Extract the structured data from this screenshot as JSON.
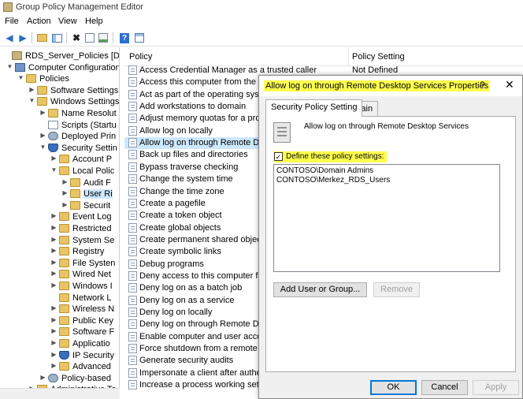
{
  "window": {
    "title": "Group Policy Management Editor"
  },
  "menu": [
    "File",
    "Action",
    "View",
    "Help"
  ],
  "toolbar": [
    "back-arrow-icon",
    "forward-arrow-icon",
    "up-folder-icon",
    "show-tree-icon",
    "delete-icon",
    "properties-icon",
    "export-icon",
    "help-icon",
    "console-icon"
  ],
  "tree": [
    {
      "label": "RDS_Server_Policies [DC.COI",
      "arrow": "",
      "icon": "policy"
    },
    {
      "label": "Computer Configuration",
      "arrow": "▼",
      "icon": "computer"
    },
    {
      "label": "Policies",
      "arrow": "▼",
      "icon": "folder"
    },
    {
      "label": "Software Settings",
      "arrow": "▶",
      "icon": "folder"
    },
    {
      "label": "Windows Settings",
      "arrow": "▼",
      "icon": "folder"
    },
    {
      "label": "Name Resolut",
      "arrow": "▶",
      "icon": "folder"
    },
    {
      "label": "Scripts (Startu",
      "arrow": "",
      "icon": "doc"
    },
    {
      "label": "Deployed Prin",
      "arrow": "▶",
      "icon": "gear"
    },
    {
      "label": "Security Settin",
      "arrow": "▼",
      "icon": "shield"
    },
    {
      "label": "Account P",
      "arrow": "▶",
      "icon": "folder"
    },
    {
      "label": "Local Polic",
      "arrow": "▼",
      "icon": "folder"
    },
    {
      "label": "Audit F",
      "arrow": "▶",
      "icon": "folder"
    },
    {
      "label": "User Ri",
      "arrow": "▶",
      "icon": "folder",
      "selected": true
    },
    {
      "label": "Securit",
      "arrow": "▶",
      "icon": "folder"
    },
    {
      "label": "Event Log",
      "arrow": "▶",
      "icon": "folder"
    },
    {
      "label": "Restricted",
      "arrow": "▶",
      "icon": "folder"
    },
    {
      "label": "System Se",
      "arrow": "▶",
      "icon": "folder"
    },
    {
      "label": "Registry",
      "arrow": "▶",
      "icon": "folder"
    },
    {
      "label": "File Systen",
      "arrow": "▶",
      "icon": "folder"
    },
    {
      "label": "Wired Net",
      "arrow": "▶",
      "icon": "folder"
    },
    {
      "label": "Windows I",
      "arrow": "▶",
      "icon": "folder"
    },
    {
      "label": "Network L",
      "arrow": "",
      "icon": "folder"
    },
    {
      "label": "Wireless N",
      "arrow": "▶",
      "icon": "folder"
    },
    {
      "label": "Public Key",
      "arrow": "▶",
      "icon": "folder"
    },
    {
      "label": "Software F",
      "arrow": "▶",
      "icon": "folder"
    },
    {
      "label": "Applicatio",
      "arrow": "▶",
      "icon": "folder"
    },
    {
      "label": "IP Security",
      "arrow": "▶",
      "icon": "shield"
    },
    {
      "label": "Advanced",
      "arrow": "▶",
      "icon": "folder"
    },
    {
      "label": "Policy-based",
      "arrow": "▶",
      "icon": "gear"
    },
    {
      "label": "Administrative Te",
      "arrow": "▶",
      "icon": "folder"
    }
  ],
  "list": {
    "col_policy": "Policy",
    "col_setting": "Policy Setting",
    "rows": [
      {
        "policy": "Access Credential Manager as a trusted caller",
        "setting": "Not Defined"
      },
      {
        "policy": "Access this computer from the netw",
        "setting": ""
      },
      {
        "policy": "Act as part of the operating system",
        "setting": ""
      },
      {
        "policy": "Add workstations to domain",
        "setting": ""
      },
      {
        "policy": "Adjust memory quotas for a proces",
        "setting": ""
      },
      {
        "policy": "Allow log on locally",
        "setting": ""
      },
      {
        "policy": "Allow log on through Remote Deskt",
        "setting": "",
        "selected": true
      },
      {
        "policy": "Back up files and directories",
        "setting": ""
      },
      {
        "policy": "Bypass traverse checking",
        "setting": ""
      },
      {
        "policy": "Change the system time",
        "setting": ""
      },
      {
        "policy": "Change the time zone",
        "setting": ""
      },
      {
        "policy": "Create a pagefile",
        "setting": ""
      },
      {
        "policy": "Create a token object",
        "setting": ""
      },
      {
        "policy": "Create global objects",
        "setting": ""
      },
      {
        "policy": "Create permanent shared objects",
        "setting": ""
      },
      {
        "policy": "Create symbolic links",
        "setting": ""
      },
      {
        "policy": "Debug programs",
        "setting": ""
      },
      {
        "policy": "Deny access to this computer from",
        "setting": ""
      },
      {
        "policy": "Deny log on as a batch job",
        "setting": ""
      },
      {
        "policy": "Deny log on as a service",
        "setting": ""
      },
      {
        "policy": "Deny log on locally",
        "setting": ""
      },
      {
        "policy": "Deny log on through Remote Deskt",
        "setting": ""
      },
      {
        "policy": "Enable computer and user accounts",
        "setting": ""
      },
      {
        "policy": "Force shutdown from a remote syst",
        "setting": ""
      },
      {
        "policy": "Generate security audits",
        "setting": ""
      },
      {
        "policy": "Impersonate a client after authentic",
        "setting": ""
      },
      {
        "policy": "Increase a process working set",
        "setting": ""
      }
    ]
  },
  "dialog": {
    "title": "Allow log on through Remote Desktop Services Properties",
    "help": "?",
    "close": "✕",
    "tabs": [
      "Security Policy Setting",
      "Explain"
    ],
    "policy_name": "Allow log on through Remote Desktop Services",
    "define_label": "Define these policy settings:",
    "define_checked": true,
    "members": [
      "CONTOSO\\Domain Admins",
      "CONTOSO\\Merkez_RDS_Users"
    ],
    "add_button": "Add User or Group...",
    "remove_button": "Remove",
    "ok_button": "OK",
    "cancel_button": "Cancel",
    "apply_button": "Apply",
    "highlight_color": "#ffff4d"
  }
}
